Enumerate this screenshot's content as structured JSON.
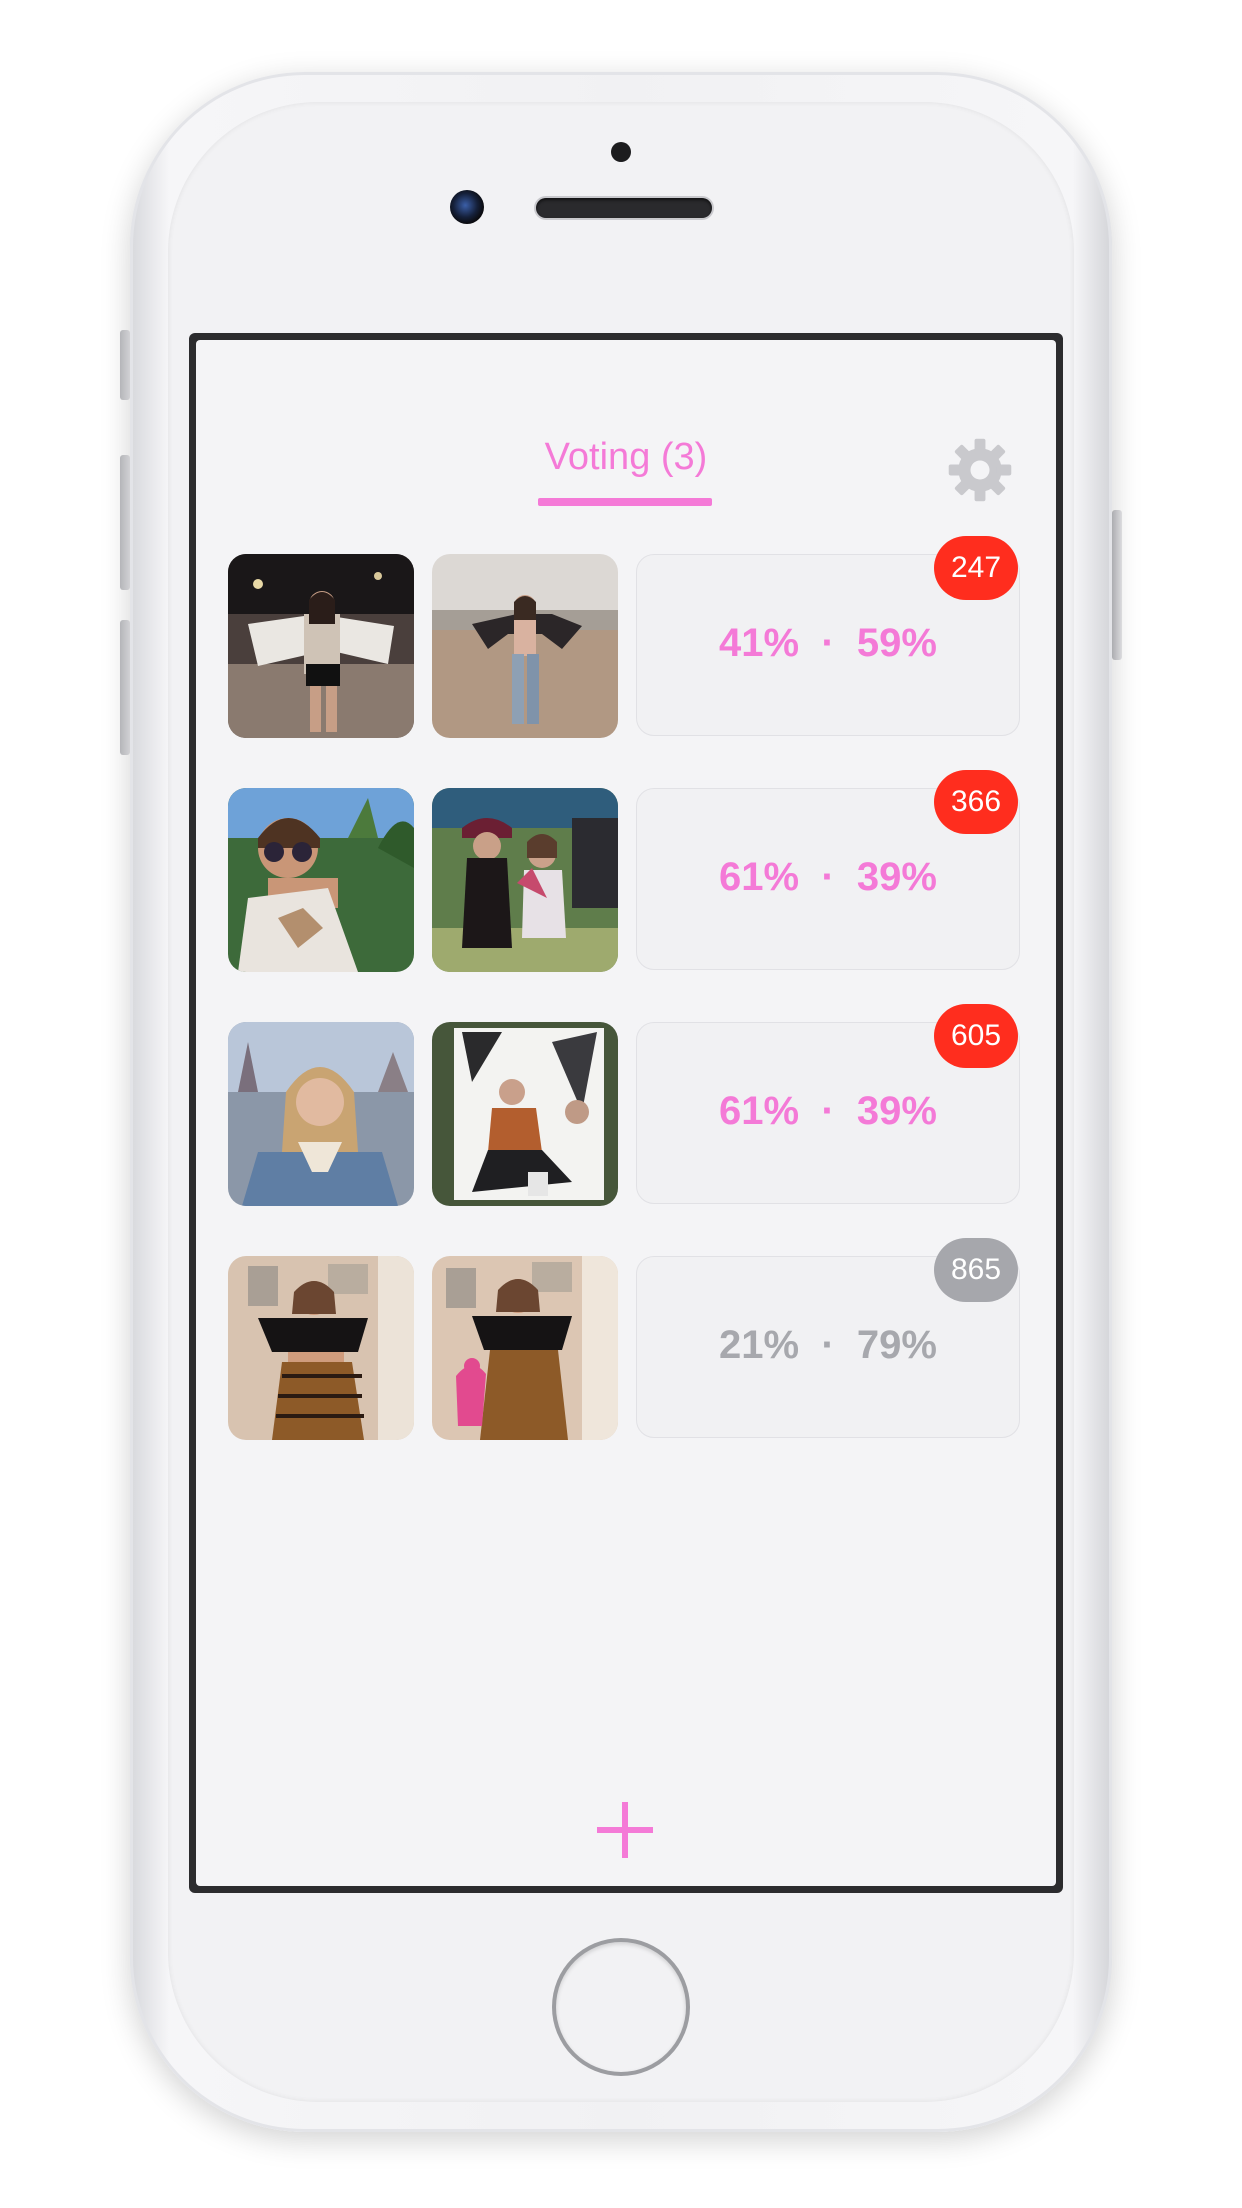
{
  "header": {
    "tab_label": "Voting (3)",
    "accent_color": "#f47ad7",
    "settings_icon": "gear-icon"
  },
  "rows": [
    {
      "stats_text": "41%  ·  59%",
      "badge": "247",
      "active": true,
      "photo_a": "photo-woman-festival-fringe-jacket",
      "photo_b": "photo-woman-hilltop-arms-open"
    },
    {
      "stats_text": "61%  ·  39%",
      "badge": "366",
      "active": true,
      "photo_a": "photo-woman-sunglasses-halter-top",
      "photo_b": "photo-two-women-festival"
    },
    {
      "stats_text": "61%  ·  39%",
      "badge": "605",
      "active": true,
      "photo_a": "photo-woman-denim-jacket-theme-park",
      "photo_b": "photo-woman-posing-mural"
    },
    {
      "stats_text": "21%  ·  79%",
      "badge": "865",
      "active": false,
      "photo_a": "photo-woman-offshoulder-top-mirror",
      "photo_b": "photo-woman-offshoulder-top-flamingo"
    }
  ],
  "colors": {
    "active_text": "#f47ad7",
    "inactive_text": "#a7a8ad",
    "badge_active": "#ff2d1e",
    "badge_inactive": "#a6a7ac"
  },
  "footer": {
    "add_icon": "plus-icon"
  }
}
